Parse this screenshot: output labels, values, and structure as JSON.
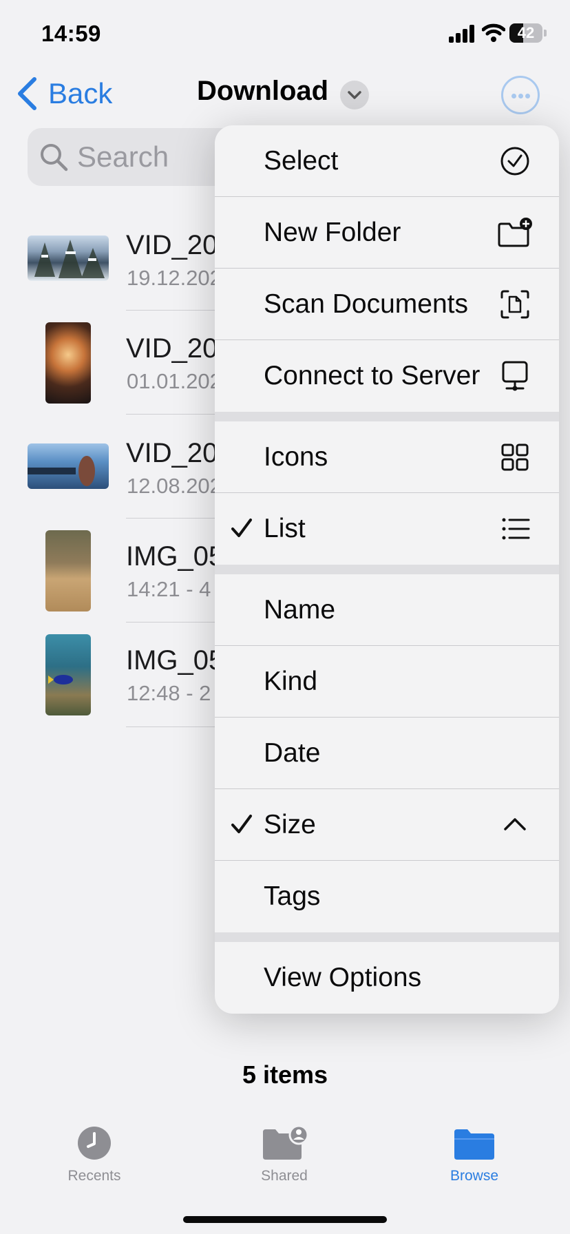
{
  "status_bar": {
    "time": "14:59",
    "battery": "42",
    "battery_level": 0.42
  },
  "nav": {
    "back_label": "Back",
    "title": "Download"
  },
  "search": {
    "placeholder": "Search"
  },
  "files": [
    {
      "name": "VID_20",
      "meta": "19.12.202"
    },
    {
      "name": "VID_20",
      "meta": "01.01.202"
    },
    {
      "name": "VID_20",
      "meta": "12.08.202"
    },
    {
      "name": "IMG_05",
      "meta": "14:21 - 4"
    },
    {
      "name": "IMG_05",
      "meta": "12:48 - 2"
    }
  ],
  "menu": {
    "actions": [
      {
        "label": "Select",
        "icon": "checkmark-circle-icon"
      },
      {
        "label": "New Folder",
        "icon": "folder-badge-plus-icon"
      },
      {
        "label": "Scan Documents",
        "icon": "doc-viewfinder-icon"
      },
      {
        "label": "Connect to Server",
        "icon": "display-network-icon"
      }
    ],
    "view": [
      {
        "label": "Icons",
        "icon": "grid-icon",
        "checked": false
      },
      {
        "label": "List",
        "icon": "list-icon",
        "checked": true
      }
    ],
    "sort": [
      {
        "label": "Name",
        "checked": false
      },
      {
        "label": "Kind",
        "checked": false
      },
      {
        "label": "Date",
        "checked": false
      },
      {
        "label": "Size",
        "checked": true,
        "icon": "chevron-up-icon"
      },
      {
        "label": "Tags",
        "checked": false
      }
    ],
    "view_options_label": "View Options"
  },
  "footer": {
    "items_count": "5 items"
  },
  "tab_bar": [
    {
      "label": "Recents",
      "icon": "clock-icon",
      "active": false
    },
    {
      "label": "Shared",
      "icon": "shared-folder-icon",
      "active": false
    },
    {
      "label": "Browse",
      "icon": "folder-icon",
      "active": true
    }
  ],
  "colors": {
    "accent": "#2a7de1",
    "inactive_tab": "#8e8e93",
    "background": "#f2f2f4"
  }
}
